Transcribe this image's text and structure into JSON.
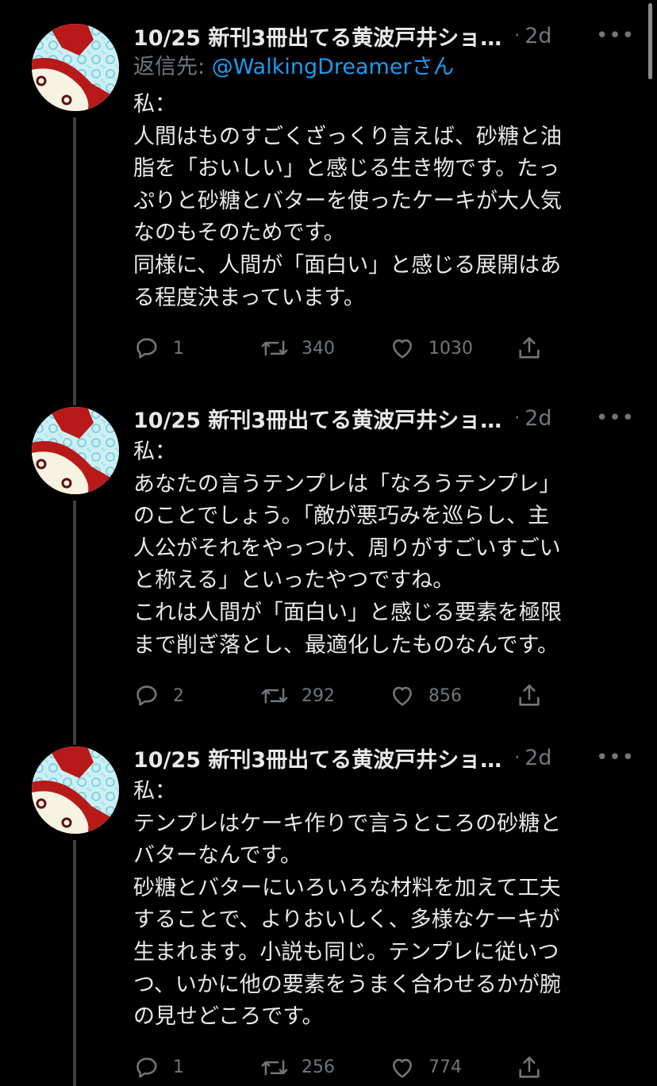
{
  "tweets": [
    {
      "author": "10/25 新刊3冊出てる黄波戸井ショ…",
      "separator": "·",
      "time": "2d",
      "more": "•••",
      "reply_prefix": "返信先: ",
      "reply_handle": "@WalkingDreamer",
      "reply_suffix": "さん",
      "text": "私：\n人間はものすごくざっくり言えば、砂糖と油\n脂を「おいしい」と感じる生き物です。たっ\nぷりと砂糖とバターを使ったケーキが大人気\nなのもそのためです。\n同様に、人間が「面白い」と感じる展開はあ\nる程度決まっています。",
      "replies": "1",
      "retweets": "340",
      "likes": "1030"
    },
    {
      "author": "10/25 新刊3冊出てる黄波戸井ショ…",
      "separator": "·",
      "time": "2d",
      "more": "•••",
      "text": "私：\nあなたの言うテンプレは「なろうテンプレ」\nのことでしょう。「敵が悪巧みを巡らし、主\n人公がそれをやっつけ、周りがすごいすごい\nと称える」といったやつですね。\nこれは人間が「面白い」と感じる要素を極限\nまで削ぎ落とし、最適化したものなんです。",
      "replies": "2",
      "retweets": "292",
      "likes": "856"
    },
    {
      "author": "10/25 新刊3冊出てる黄波戸井ショ…",
      "separator": "·",
      "time": "2d",
      "more": "•••",
      "text": "私：\nテンプレはケーキ作りで言うところの砂糖と\nバターなんです。\n砂糖とバターにいろいろな材料を加えて工夫\nすることで、よりおいしく、多様なケーキが\n生まれます。小説も同じ。テンプレに従いつ\nつ、いかに他の要素をうまく合わせるかが腕\nの見せどころです。",
      "replies": "1",
      "retweets": "256",
      "likes": "774"
    }
  ],
  "icons": {
    "reply": "reply-icon",
    "retweet": "retweet-icon",
    "like": "heart-icon",
    "share": "share-icon",
    "more": "more-icon"
  },
  "colors": {
    "background": "#000000",
    "text": "#e7e9ea",
    "muted": "#71767b",
    "link": "#1d9bf0",
    "thread_line": "#3a3f44"
  }
}
